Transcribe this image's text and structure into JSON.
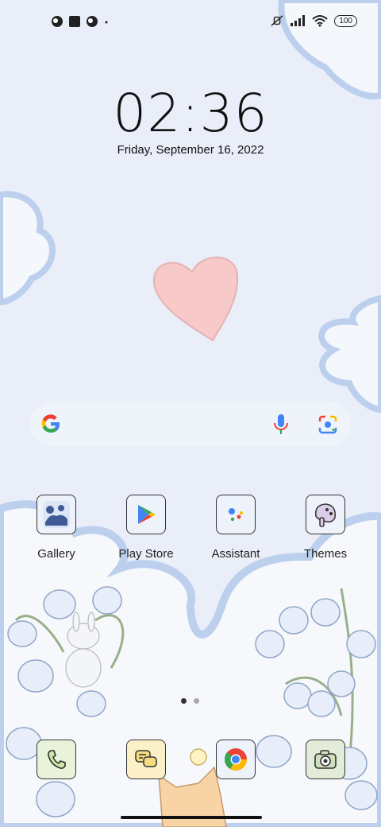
{
  "status_bar": {
    "left_icons": [
      "app-notification-icon",
      "square-notification-icon",
      "app-notification-icon",
      "more-dot-icon"
    ],
    "right_icons": [
      "silent-icon",
      "signal-icon",
      "wifi-icon"
    ],
    "battery": "100"
  },
  "lock": {
    "time": "02:36",
    "date": "Friday, September 16, 2022"
  },
  "search": {
    "icons": [
      "google-icon",
      "mic-icon",
      "lens-icon"
    ]
  },
  "apps": [
    {
      "label": "Gallery",
      "icon": "gallery-icon"
    },
    {
      "label": "Play Store",
      "icon": "play-store-icon"
    },
    {
      "label": "Assistant",
      "icon": "assistant-icon"
    },
    {
      "label": "Themes",
      "icon": "themes-icon"
    }
  ],
  "dock": [
    {
      "icon": "phone-icon"
    },
    {
      "icon": "messages-icon"
    },
    {
      "icon": "chrome-icon"
    },
    {
      "icon": "camera-icon"
    }
  ],
  "pager": {
    "pages": 2,
    "current": 1
  },
  "colors": {
    "background": "#e9eef9",
    "cloud_outline": "#bcd0ee",
    "heart": "#f8c9c9",
    "active_dot": "#333333",
    "inactive_dot": "#aaaaaa"
  }
}
